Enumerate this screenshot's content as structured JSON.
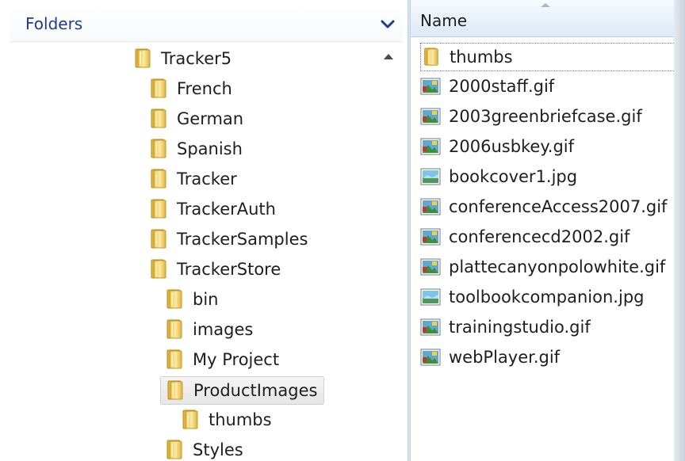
{
  "folders_pane": {
    "title": "Folders",
    "tree": [
      {
        "label": "Tracker5",
        "level": 0
      },
      {
        "label": "French",
        "level": 1
      },
      {
        "label": "German",
        "level": 1
      },
      {
        "label": "Spanish",
        "level": 1
      },
      {
        "label": "Tracker",
        "level": 1
      },
      {
        "label": "TrackerAuth",
        "level": 1
      },
      {
        "label": "TrackerSamples",
        "level": 1
      },
      {
        "label": "TrackerStore",
        "level": 1
      },
      {
        "label": "bin",
        "level": 2
      },
      {
        "label": "images",
        "level": 2
      },
      {
        "label": "My Project",
        "level": 2
      },
      {
        "label": "ProductImages",
        "level": 2,
        "selected": true
      },
      {
        "label": "thumbs",
        "level": 3
      },
      {
        "label": "Styles",
        "level": 2
      }
    ]
  },
  "files_pane": {
    "column_header": "Name",
    "items": [
      {
        "label": "thumbs",
        "icon": "folder-icon"
      },
      {
        "label": "2000staff.gif",
        "icon": "gif-image-icon"
      },
      {
        "label": "2003greenbriefcase.gif",
        "icon": "gif-image-icon"
      },
      {
        "label": "2006usbkey.gif",
        "icon": "gif-image-icon"
      },
      {
        "label": "bookcover1.jpg",
        "icon": "jpg-image-icon"
      },
      {
        "label": "conferenceAccess2007.gif",
        "icon": "gif-image-icon"
      },
      {
        "label": "conferencecd2002.gif",
        "icon": "gif-image-icon"
      },
      {
        "label": "plattecanyonpolowhite.gif",
        "icon": "gif-image-icon"
      },
      {
        "label": "toolbookcompanion.jpg",
        "icon": "jpg-image-icon"
      },
      {
        "label": "trainingstudio.gif",
        "icon": "gif-image-icon"
      },
      {
        "label": "webPlayer.gif",
        "icon": "gif-image-icon"
      }
    ]
  },
  "colors": {
    "header_text": "#1e3d8f",
    "folder_yellow": "#f3d779",
    "selection_bg": "#ececec"
  }
}
